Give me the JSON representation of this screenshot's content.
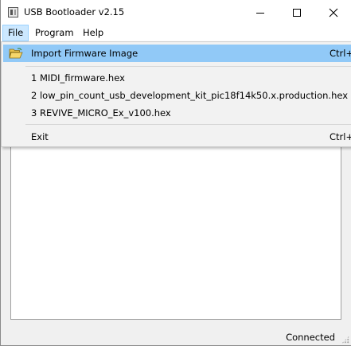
{
  "window": {
    "title": "USB Bootloader v2.15"
  },
  "menubar": {
    "items": [
      "File",
      "Program",
      "Help"
    ]
  },
  "file_menu": {
    "import_label": "Import Firmware Image",
    "import_shortcut": "Ctrl+O",
    "recent": [
      "1 MIDI_firmware.hex",
      "2 low_pin_count_usb_development_kit_pic18f14k50.x.production.hex",
      "3 REVIVE_MICRO_Ex_v100.hex"
    ],
    "exit_label": "Exit",
    "exit_shortcut": "Ctrl+Q"
  },
  "status": {
    "text": "Connected"
  },
  "colors": {
    "menu_highlight": "#91c9f7",
    "menubar_active": "#cce8ff"
  },
  "icons": [
    "app-icon",
    "minimize-icon",
    "maximize-icon",
    "close-icon",
    "open-folder-icon",
    "size-grip-icon"
  ]
}
